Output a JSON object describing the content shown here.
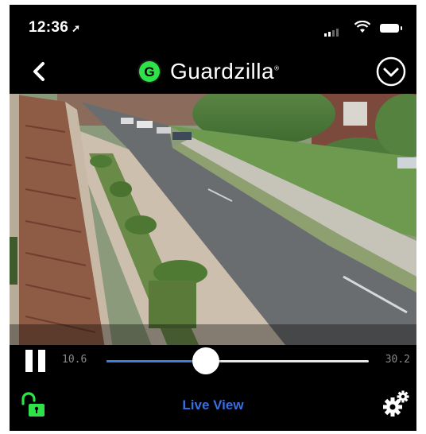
{
  "status_bar": {
    "time": "12:36",
    "location_arrow": "location-arrow-icon",
    "icons": [
      "signal-icon",
      "wifi-icon",
      "battery-icon"
    ]
  },
  "header": {
    "back_icon": "chevron-left-icon",
    "brand_logo": "G",
    "brand_name": "Guardzilla",
    "menu_icon": "chevron-down-circle-icon"
  },
  "video": {
    "content": "live-camera-feed"
  },
  "controls": {
    "play_state_icon": "pause-icon",
    "time_start": "10.6",
    "time_end": "30.2",
    "progress": 0.38,
    "progress_color": "#3d7fe0"
  },
  "bottom_bar": {
    "lock_icon": "unlock-icon",
    "live_view_label": "Live View",
    "settings_icon": "gears-icon"
  },
  "colors": {
    "background": "#000000",
    "accent_green": "#2ee34a",
    "link_blue": "#3b6fe0"
  }
}
